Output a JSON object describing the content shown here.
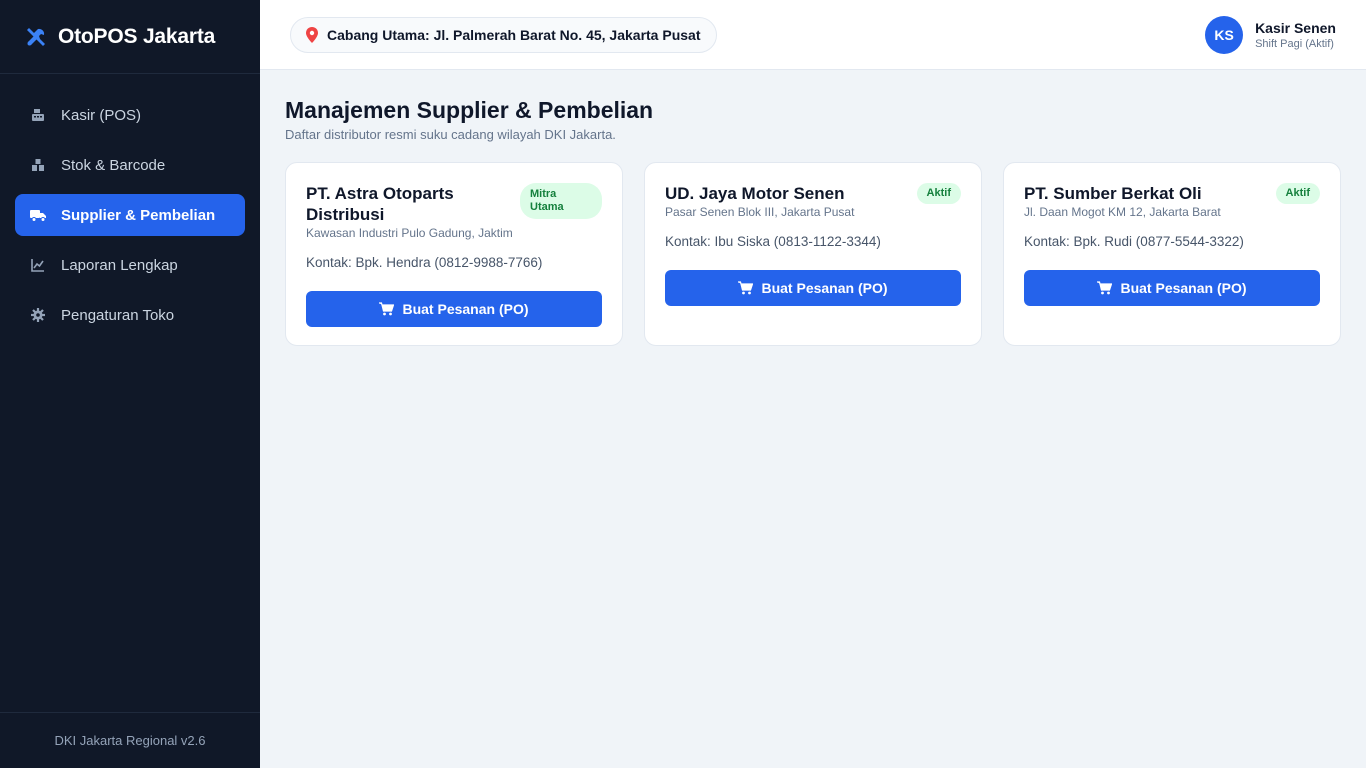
{
  "app": {
    "name": "OtoPOS Jakarta",
    "version_label": "DKI Jakarta Regional v2.6",
    "brand_color": "#3b82f6",
    "accent": "#2563eb"
  },
  "sidebar": {
    "items": [
      {
        "label": "Kasir (POS)",
        "icon": "cash-register-icon",
        "active": false
      },
      {
        "label": "Stok & Barcode",
        "icon": "boxes-icon",
        "active": false
      },
      {
        "label": "Supplier & Pembelian",
        "icon": "truck-icon",
        "active": true
      },
      {
        "label": "Laporan Lengkap",
        "icon": "chart-line-icon",
        "active": false
      },
      {
        "label": "Pengaturan Toko",
        "icon": "gear-icon",
        "active": false
      }
    ]
  },
  "header": {
    "branch": "Cabang Utama: Jl. Palmerah Barat No. 45, Jakarta Pusat",
    "user": {
      "initials": "KS",
      "name": "Kasir Senen",
      "shift": "Shift Pagi (Aktif)"
    }
  },
  "main": {
    "title": "Manajemen Supplier & Pembelian",
    "subtitle": "Daftar distributor resmi suku cadang wilayah DKI Jakarta.",
    "suppliers": [
      {
        "name": "PT. Astra Otoparts Distribusi",
        "badge": "Mitra Utama",
        "address": "Kawasan Industri Pulo Gadung, Jaktim",
        "contact": "Kontak: Bpk. Hendra (0812-9988-7766)",
        "button": "Buat Pesanan (PO)"
      },
      {
        "name": "UD. Jaya Motor Senen",
        "badge": "Aktif",
        "address": "Pasar Senen Blok III, Jakarta Pusat",
        "contact": "Kontak: Ibu Siska (0813-1122-3344)",
        "button": "Buat Pesanan (PO)"
      },
      {
        "name": "PT. Sumber Berkat Oli",
        "badge": "Aktif",
        "address": "Jl. Daan Mogot KM 12, Jakarta Barat",
        "contact": "Kontak: Bpk. Rudi (0877-5544-3322)",
        "button": "Buat Pesanan (PO)"
      }
    ]
  }
}
